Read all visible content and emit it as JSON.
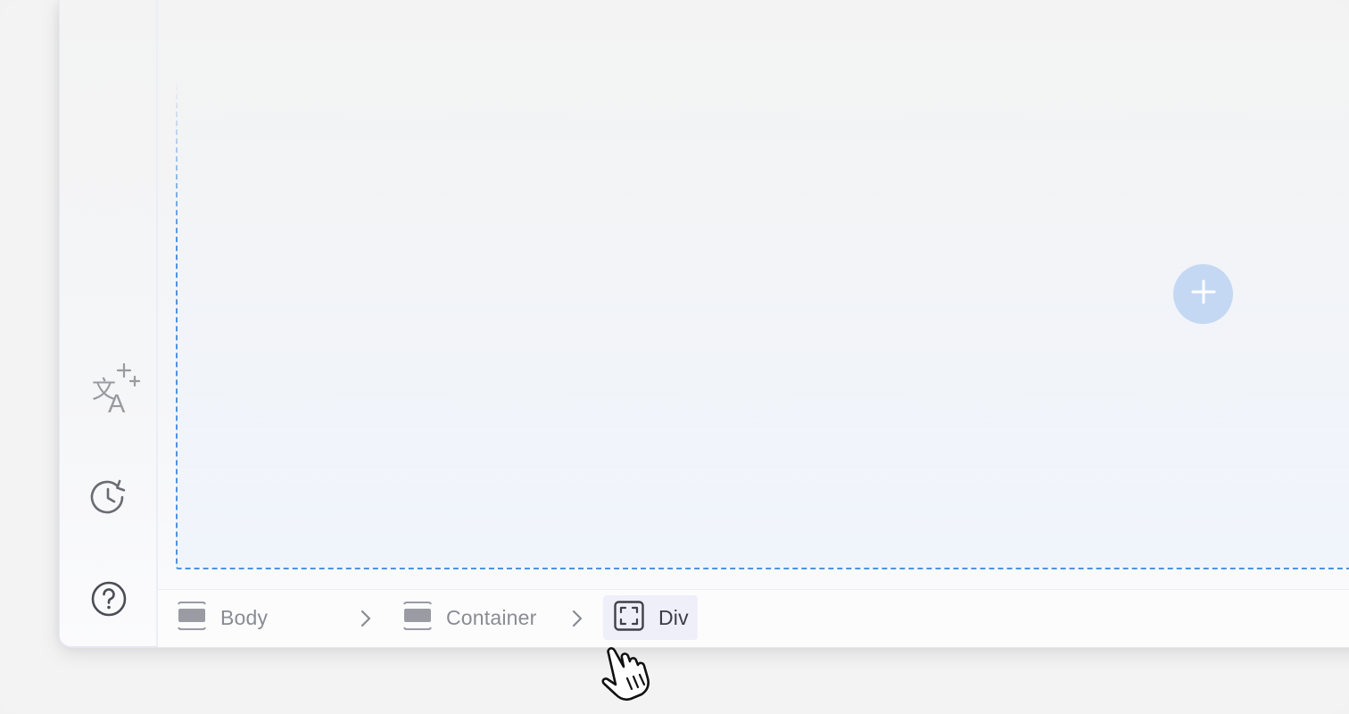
{
  "breadcrumb": {
    "items": [
      {
        "label": "Body",
        "icon": "layout-section-icon"
      },
      {
        "label": "Container",
        "icon": "layout-section-icon"
      },
      {
        "label": "Div",
        "icon": "div-frame-icon",
        "selected": true
      }
    ],
    "separator_icon": "chevron-right-icon"
  },
  "sidebar": {
    "icons": [
      "translate-ai-icon",
      "history-icon",
      "help-icon"
    ]
  },
  "canvas": {
    "add_button_icon": "plus-icon",
    "accent": "#4f93de"
  },
  "colors": {
    "selected_crumb_bg": "#efeff9",
    "add_button_bg": "#c5d8f3"
  }
}
